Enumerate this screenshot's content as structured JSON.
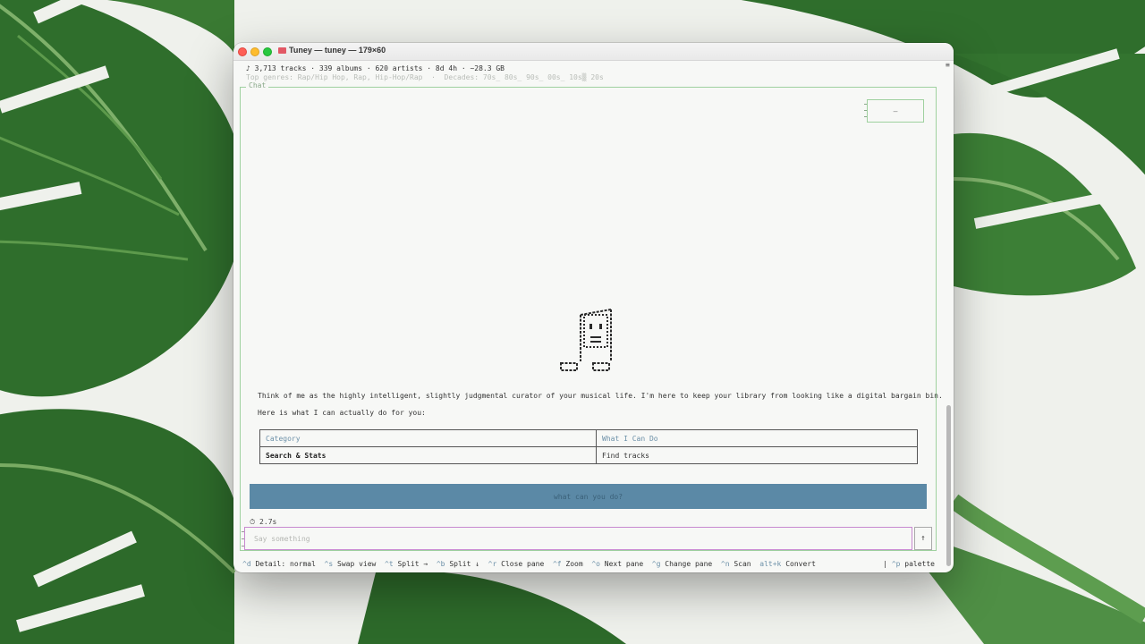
{
  "window": {
    "title": "Tuney — tuney — 179×60"
  },
  "header": {
    "stats": "♪ 3,713 tracks · 339 albums · 620 artists · 8d 4h · ~28.3 GB",
    "genres": "Top genres: Rap/Hip Hop, Rap, Hip-Hop/Rap  ·  Decades: 70s_ 80s_ 90s_ 00s_ 10s▒ 20s"
  },
  "chat": {
    "label": "Chat",
    "mini_box": "–",
    "intro": "Think of me as the highly intelligent, slightly judgmental curator of your musical life. I'm here to keep your library from looking like a digital bargain bin.",
    "intro2": "Here is what I can actually do for you:",
    "table": {
      "headers": [
        "Category",
        "What I Can Do"
      ],
      "rows": [
        [
          "Search & Stats",
          "Find tracks"
        ]
      ]
    },
    "suggestion": "what can you do?",
    "timer": "⏱ 2.7s",
    "input_placeholder": "Say something",
    "send": "↑"
  },
  "footer": {
    "shortcuts": [
      {
        "key": "^d",
        "label": "Detail: normal"
      },
      {
        "key": "^s",
        "label": "Swap view"
      },
      {
        "key": "^t",
        "label": "Split →"
      },
      {
        "key": "^b",
        "label": "Split ↓"
      },
      {
        "key": "^r",
        "label": "Close pane"
      },
      {
        "key": "^f",
        "label": "Zoom"
      },
      {
        "key": "^o",
        "label": "Next pane"
      },
      {
        "key": "^g",
        "label": "Change pane"
      },
      {
        "key": "^n",
        "label": "Scan"
      },
      {
        "key": "alt+k",
        "label": "Convert"
      }
    ],
    "palette_key": "^p",
    "palette_label": "palette"
  }
}
